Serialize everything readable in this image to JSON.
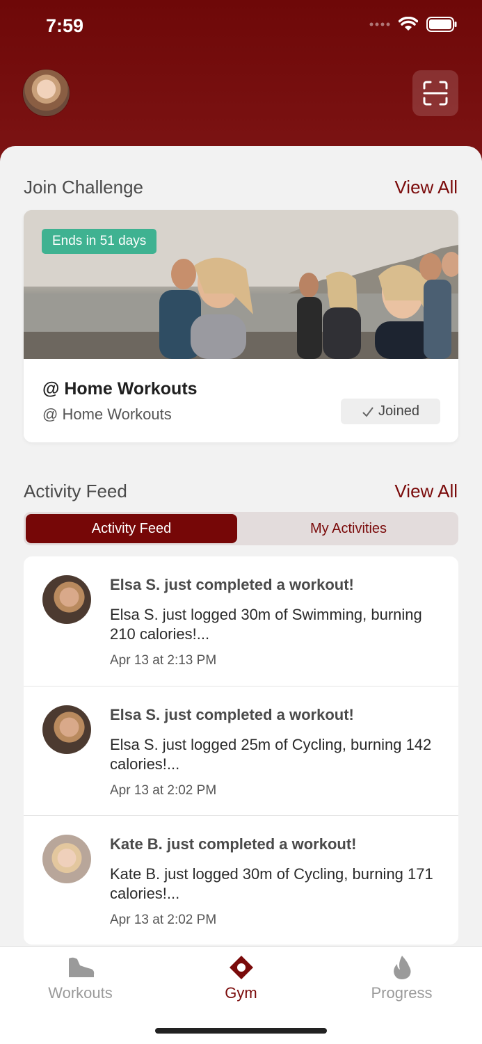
{
  "status_bar": {
    "time": "7:59"
  },
  "header": {
    "scan_icon": "scan-icon",
    "avatar": "profile-avatar"
  },
  "challenge_section": {
    "title": "Join Challenge",
    "view_all": "View All",
    "card": {
      "badge": "Ends in 51 days",
      "title": "@ Home Workouts",
      "subtitle": "@ Home Workouts",
      "joined_label": "Joined"
    }
  },
  "activity_section": {
    "title": "Activity Feed",
    "view_all": "View All",
    "tabs": [
      {
        "label": "Activity Feed",
        "active": true
      },
      {
        "label": "My Activities",
        "active": false
      }
    ],
    "items": [
      {
        "title": "Elsa S. just completed a workout!",
        "text": "Elsa S. just logged 30m of Swimming, burning 210 calories!...",
        "time": "Apr 13 at 2:13 PM"
      },
      {
        "title": "Elsa S. just completed a workout!",
        "text": "Elsa S. just logged 25m of Cycling, burning 142 calories!...",
        "time": "Apr 13 at 2:02 PM"
      },
      {
        "title": "Kate B. just completed a workout!",
        "text": "Kate B. just logged 30m of Cycling, burning 171 calories!...",
        "time": "Apr 13 at 2:02 PM"
      }
    ]
  },
  "tab_bar": {
    "tabs": [
      {
        "label": "Workouts",
        "icon": "shoe-icon",
        "active": false
      },
      {
        "label": "Gym",
        "icon": "location-diamond-icon",
        "active": true
      },
      {
        "label": "Progress",
        "icon": "flame-icon",
        "active": false
      }
    ]
  },
  "colors": {
    "brand": "#760707",
    "badge_green": "#3fb291"
  }
}
